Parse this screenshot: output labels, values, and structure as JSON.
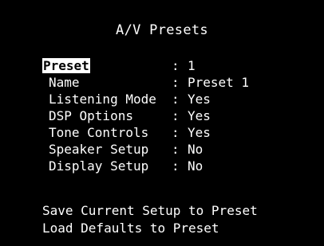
{
  "title": "A/V Presets",
  "separator": ":",
  "items": [
    {
      "label": "Preset",
      "value": "1"
    },
    {
      "label": "Name",
      "value": "Preset 1"
    },
    {
      "label": "Listening Mode",
      "value": "Yes"
    },
    {
      "label": "DSP Options",
      "value": "Yes"
    },
    {
      "label": "Tone Controls",
      "value": "Yes"
    },
    {
      "label": "Speaker Setup",
      "value": "No"
    },
    {
      "label": "Display Setup",
      "value": "No"
    }
  ],
  "actions": [
    {
      "label": "Save Current Setup to Preset"
    },
    {
      "label": "Load Defaults to Preset"
    }
  ],
  "colors": {
    "background": "#000000",
    "text": "#ffffff",
    "highlight_bg": "#ffffff",
    "highlight_text": "#000000"
  }
}
